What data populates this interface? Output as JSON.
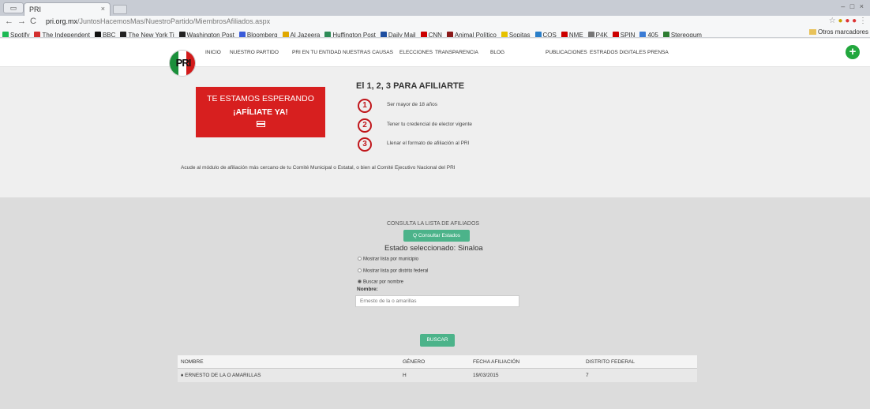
{
  "browser": {
    "tab_title": "PRI",
    "tab_close": "×",
    "back": "←",
    "forward": "→",
    "reload": "C",
    "url_domain": "pri.org.mx",
    "url_path": "/JuntosHacemosMas/NuestroPartido/MiembrosAfiliados.aspx",
    "window_controls": "– □ ×",
    "bookmarks": [
      {
        "label": "Spotify",
        "color": "#1db954"
      },
      {
        "label": "The Independent",
        "color": "#d32f2f"
      },
      {
        "label": "BBC",
        "color": "#111111"
      },
      {
        "label": "The New York Ti",
        "color": "#222222"
      },
      {
        "label": "Washington Post",
        "color": "#222222"
      },
      {
        "label": "Bloomberg",
        "color": "#3a5bd9"
      },
      {
        "label": "Al Jazeera",
        "color": "#e0a800"
      },
      {
        "label": "Huffington Post",
        "color": "#2e8b57"
      },
      {
        "label": "Daily Mail",
        "color": "#1f4fa0"
      },
      {
        "label": "CNN",
        "color": "#cc0000"
      },
      {
        "label": "Animal Político",
        "color": "#8b1a1a"
      },
      {
        "label": "Sopitas",
        "color": "#e6c200"
      },
      {
        "label": "COS",
        "color": "#2a7fc9"
      },
      {
        "label": "NME",
        "color": "#cc0000"
      },
      {
        "label": "P4K",
        "color": "#777777"
      },
      {
        "label": "SPIN",
        "color": "#cc0000"
      },
      {
        "label": "405",
        "color": "#3a7bd5"
      },
      {
        "label": "Stereogum",
        "color": "#2e7d32"
      }
    ],
    "other_bookmarks": "Otros marcadores"
  },
  "nav": {
    "logo_text": "PRI",
    "items": [
      "INICIO",
      "NUESTRO PARTIDO",
      "PRI EN TU ENTIDAD",
      "NUESTRAS CAUSAS",
      "ELECCIONES",
      "TRANSPARENCIA",
      "BLOG",
      "PUBLICACIONES",
      "ESTRADOS DIGITALES",
      "PRENSA"
    ],
    "add_label": "+"
  },
  "promo": {
    "title": "TE ESTAMOS ESPERANDO",
    "cta": "¡AFÍLIATE YA!"
  },
  "steps": {
    "title": "El 1, 2, 3 PARA AFILIARTE",
    "items": [
      {
        "num": "1",
        "text": "Ser mayor de 18 años"
      },
      {
        "num": "2",
        "text": "Tener tu credencial de elector vigente"
      },
      {
        "num": "3",
        "text": "Llenar el formato de afiliación al PRI"
      }
    ],
    "note": "Acude al módulo de afiliación más cercano de tu Comité Municipal o Estatal, o bien al Comité Ejecutivo Nacional del PRI"
  },
  "consulta": {
    "label": "CONSULTA LA LISTA DE AFILIADOS",
    "button": "Q Consultar Estados",
    "estado": "Estado seleccionado: Sinaloa",
    "options": [
      {
        "label": "Mostrar lista por municipio",
        "selected": false
      },
      {
        "label": "Mostrar lista por distrito federal",
        "selected": false
      },
      {
        "label": "Buscar por nombre",
        "selected": true
      }
    ],
    "field_label": "Nombre:",
    "field_value": "Ernesto de la o amarillas",
    "search_button": "BUSCAR"
  },
  "table": {
    "headers": [
      "NOMBRE",
      "GÉNERO",
      "FECHA AFILIACIÓN",
      "DISTRITO FEDERAL"
    ],
    "rows": [
      [
        "♦ ERNESTO DE LA O AMARILLAS",
        "H",
        "19/03/2015",
        "7"
      ]
    ]
  }
}
